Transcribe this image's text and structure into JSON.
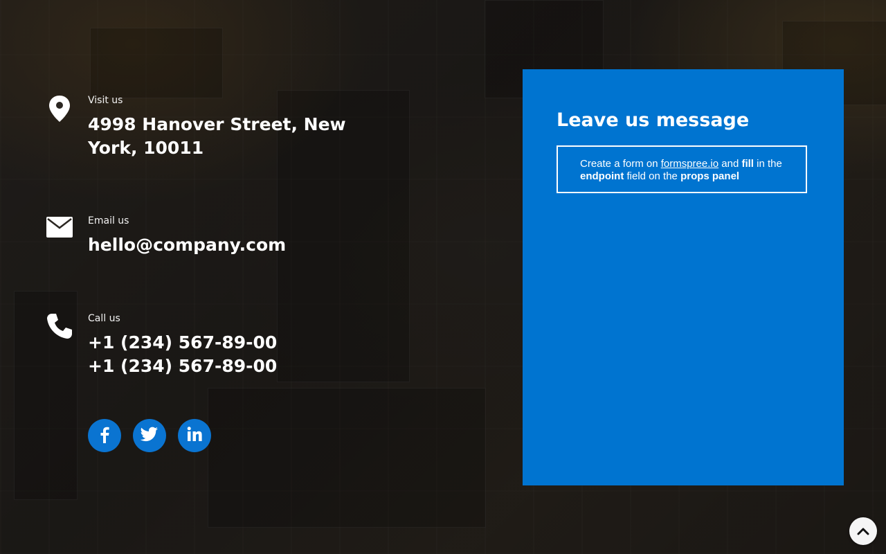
{
  "contact": {
    "visit": {
      "icon": "map-pin-icon",
      "label": "Visit us",
      "address_line1": "4998 Hanover Street, New",
      "address_line2": "York, 10011"
    },
    "email": {
      "icon": "envelope-icon",
      "label": "Email us",
      "value": "hello@company.com"
    },
    "call": {
      "icon": "phone-icon",
      "label": "Call us",
      "phone1": "+1 (234) 567-89-00",
      "phone2": "+1 (234) 567-89-00"
    },
    "social": [
      {
        "name": "facebook",
        "icon": "facebook-icon"
      },
      {
        "name": "twitter",
        "icon": "twitter-icon"
      },
      {
        "name": "linkedin",
        "icon": "linkedin-icon"
      }
    ]
  },
  "message_panel": {
    "title": "Leave us message",
    "notice": {
      "part1": "Create a form on ",
      "link": "formspree.io",
      "part2": " and ",
      "bold1": "fill",
      "part3": " in the ",
      "bold2": "endpoint",
      "part4": " field on the ",
      "bold3": "props panel"
    }
  },
  "scroll_top": {
    "icon": "chevron-up-icon"
  },
  "colors": {
    "accent_blue": "#0074d0",
    "social_blue": "#0a74d1",
    "text": "#ffffff"
  }
}
